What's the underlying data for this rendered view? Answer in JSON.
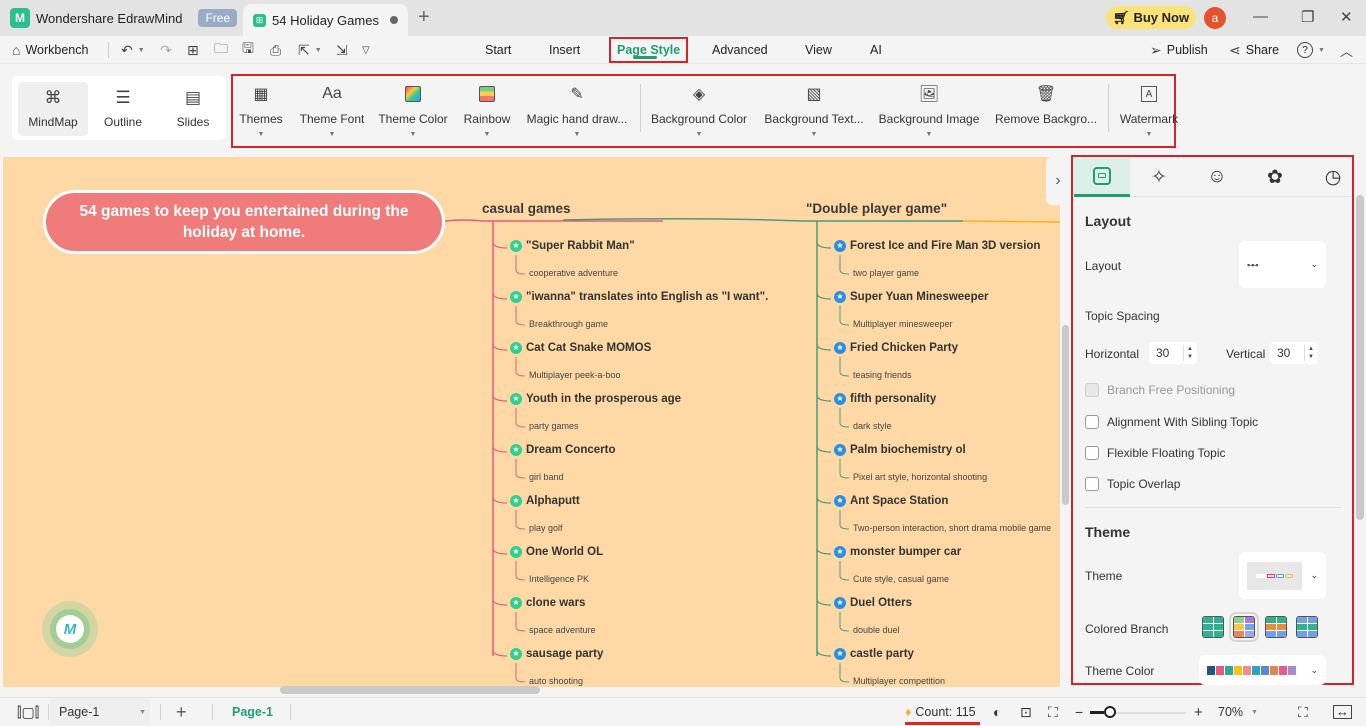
{
  "titlebar": {
    "app_name": "Wondershare EdrawMind",
    "plan_badge": "Free",
    "doc_tab": "54 Holiday Games",
    "new_tab": "+",
    "buy_now": "Buy Now",
    "avatar_letter": "a",
    "minimize": "—",
    "maximize": "❐",
    "close": "✕"
  },
  "menubar": {
    "workbench": "Workbench",
    "tabs": [
      "Start",
      "Insert",
      "Page Style",
      "Advanced",
      "View",
      "AI"
    ],
    "active_tab": "Page Style",
    "publish": "Publish",
    "share": "Share",
    "help": "?"
  },
  "ribbon": {
    "views": [
      {
        "label": "MindMap",
        "icon": "mindmap-icon",
        "active": true
      },
      {
        "label": "Outline",
        "icon": "outline-icon",
        "active": false
      },
      {
        "label": "Slides",
        "icon": "slides-icon",
        "active": false
      }
    ],
    "buttons": [
      {
        "label": "Themes",
        "icon": "themes-icon"
      },
      {
        "label": "Theme Font",
        "icon": "font-icon"
      },
      {
        "label": "Theme Color",
        "icon": "theme-color-icon"
      },
      {
        "label": "Rainbow",
        "icon": "rainbow-icon"
      },
      {
        "label": "Magic hand draw...",
        "icon": "hand-draw-icon"
      },
      {
        "label": "Background Color",
        "icon": "paint-bucket-icon"
      },
      {
        "label": "Background Text...",
        "icon": "background-texture-icon"
      },
      {
        "label": "Background Image",
        "icon": "background-image-icon"
      },
      {
        "label": "Remove Backgro...",
        "icon": "remove-background-icon"
      },
      {
        "label": "Watermark",
        "icon": "watermark-icon"
      }
    ]
  },
  "canvas": {
    "central_topic": "54 games to keep you entertained during the holiday at home.",
    "branches": [
      {
        "title": "casual games",
        "color": "#e06070",
        "topics": [
          {
            "title": "\"Super Rabbit Man\"",
            "sub": "cooperative adventure"
          },
          {
            "title": "\"iwanna\" translates into English as \"I want\".",
            "sub": "Breakthrough game"
          },
          {
            "title": "Cat Cat Snake MOMOS",
            "sub": "Multiplayer peek-a-boo"
          },
          {
            "title": "Youth in the prosperous age",
            "sub": "party games"
          },
          {
            "title": "Dream Concerto",
            "sub": "girl band"
          },
          {
            "title": "Alphaputt",
            "sub": "play golf"
          },
          {
            "title": "One World OL",
            "sub": "Intelligence PK"
          },
          {
            "title": "clone wars",
            "sub": "space adventure"
          },
          {
            "title": "sausage party",
            "sub": "auto shooting"
          }
        ]
      },
      {
        "title": "\"Double player game\"",
        "color": "#4a9a80",
        "topics": [
          {
            "title": "Forest Ice and Fire Man 3D version",
            "sub": "two player game"
          },
          {
            "title": "Super Yuan Minesweeper",
            "sub": "Multiplayer minesweeper"
          },
          {
            "title": "Fried Chicken Party",
            "sub": "teasing friends"
          },
          {
            "title": "fifth personality",
            "sub": "dark style"
          },
          {
            "title": "Palm biochemistry ol",
            "sub": "Pixel art style, horizontal shooting"
          },
          {
            "title": "Ant Space Station",
            "sub": "Two-person interaction, short drama mobile game"
          },
          {
            "title": "monster bumper car",
            "sub": "Cute style, casual game"
          },
          {
            "title": "Duel Otters",
            "sub": "double duel"
          },
          {
            "title": "castle party",
            "sub": "Multiplayer competition"
          }
        ]
      }
    ]
  },
  "panel": {
    "tabs": [
      "layout-icon",
      "ai-sparkle-icon",
      "emoji-icon",
      "badge-icon",
      "history-icon"
    ],
    "layout_section": "Layout",
    "layout_label": "Layout",
    "topic_spacing": "Topic Spacing",
    "horizontal_label": "Horizontal",
    "horizontal_value": "30",
    "vertical_label": "Vertical",
    "vertical_value": "30",
    "checkboxes": [
      {
        "label": "Branch Free Positioning",
        "checked": false,
        "disabled": true
      },
      {
        "label": "Alignment With Sibling Topic",
        "checked": false,
        "disabled": false
      },
      {
        "label": "Flexible Floating Topic",
        "checked": false,
        "disabled": false
      },
      {
        "label": "Topic Overlap",
        "checked": false,
        "disabled": false
      }
    ],
    "theme_section": "Theme",
    "theme_label": "Theme",
    "colored_branch_label": "Colored Branch",
    "colored_branch_selected": 2,
    "theme_color_label": "Theme Color",
    "theme_colors": [
      "#23557e",
      "#e85a78",
      "#2ea89a",
      "#f5c21a",
      "#ef8f87",
      "#2aa5c8",
      "#5c86d0",
      "#d98a4a",
      "#e25c8f",
      "#a98ad0"
    ]
  },
  "statusbar": {
    "page_select": "Page-1",
    "add_page": "+",
    "active_page": "Page-1",
    "count": "Count: 115",
    "zoom_minus": "−",
    "zoom_plus": "+",
    "zoom_level": "70%",
    "zoom_fraction": 0.3
  }
}
